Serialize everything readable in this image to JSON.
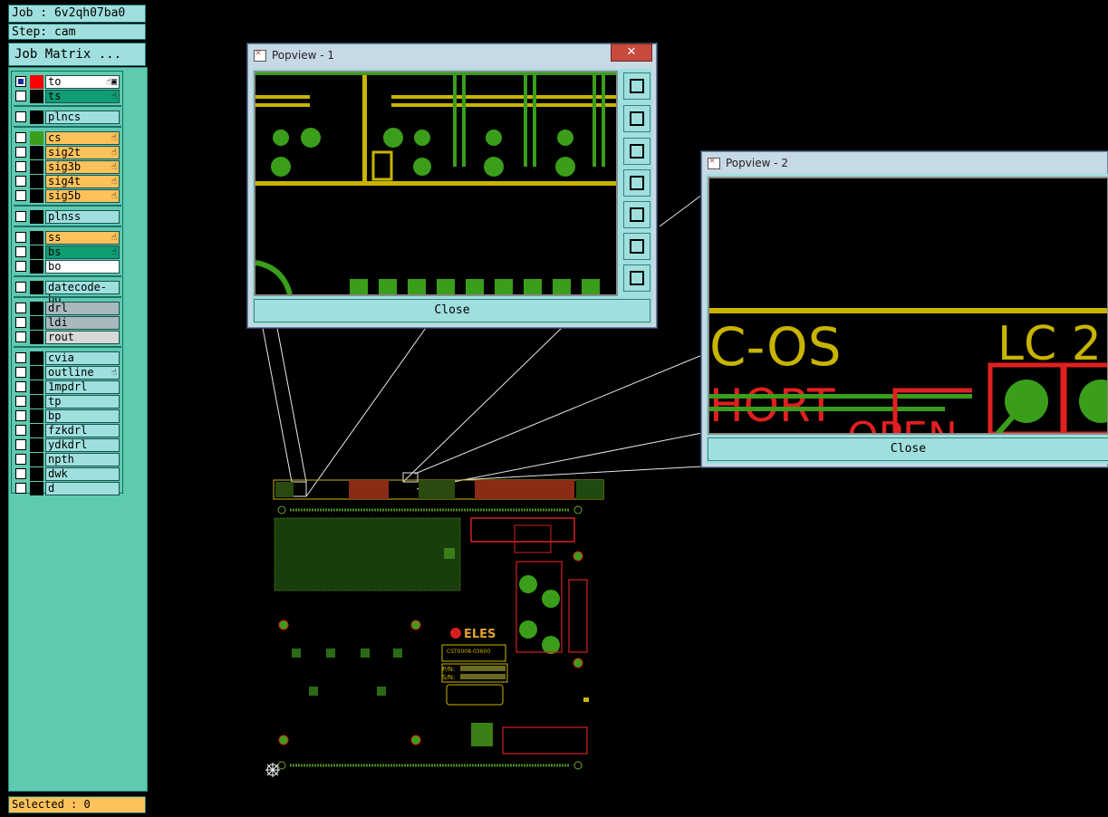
{
  "job": "Job : 6v2qh07ba0",
  "step": "Step: cam",
  "job_matrix": "Job Matrix ...",
  "selected": "Selected : 0",
  "colors": {
    "teal": "#9fe0de",
    "panel": "#5ecab0",
    "orange": "#ffc25a",
    "green": "#0f9e74",
    "silver": "#a9b8bd"
  },
  "layers": [
    {
      "name": "to",
      "bg": "#ffffff",
      "sw": "#ff0000",
      "on": true,
      "mark": "☝▣"
    },
    {
      "name": "ts",
      "bg": "#0f9e74",
      "sw": "#000000",
      "on": false,
      "mark": "☝"
    },
    {
      "name": "plncs",
      "bg": "#9fe0de",
      "sw": "#000000",
      "on": false,
      "mark": ""
    },
    {
      "name": "cs",
      "bg": "#ffc25a",
      "sw": "#3a9e1a",
      "on": false,
      "mark": "☝"
    },
    {
      "name": "sig2t",
      "bg": "#ffc25a",
      "sw": "#000000",
      "on": false,
      "mark": "☝"
    },
    {
      "name": "sig3b",
      "bg": "#ffc25a",
      "sw": "#000000",
      "on": false,
      "mark": "☝"
    },
    {
      "name": "sig4t",
      "bg": "#ffc25a",
      "sw": "#000000",
      "on": false,
      "mark": "☝"
    },
    {
      "name": "sig5b",
      "bg": "#ffc25a",
      "sw": "#000000",
      "on": false,
      "mark": "☝"
    },
    {
      "name": "plnss",
      "bg": "#9fe0de",
      "sw": "#000000",
      "on": false,
      "mark": ""
    },
    {
      "name": "ss",
      "bg": "#ffc25a",
      "sw": "#000000",
      "on": false,
      "mark": "☝"
    },
    {
      "name": "bs",
      "bg": "#0f9e74",
      "sw": "#000000",
      "on": false,
      "mark": "☝"
    },
    {
      "name": "bo",
      "bg": "#ffffff",
      "sw": "#000000",
      "on": false,
      "mark": ""
    },
    {
      "name": "datecode-bo",
      "bg": "#9fe0de",
      "sw": "#000000",
      "on": false,
      "mark": ""
    },
    {
      "name": "drl",
      "bg": "#a9b8bd",
      "sw": "#000000",
      "on": false,
      "mark": ""
    },
    {
      "name": "ldi",
      "bg": "#a9b8bd",
      "sw": "#000000",
      "on": false,
      "mark": ""
    },
    {
      "name": "rout",
      "bg": "#d8d8d8",
      "sw": "#000000",
      "on": false,
      "mark": ""
    },
    {
      "name": "cvia",
      "bg": "#9fe0de",
      "sw": "#000000",
      "on": false,
      "mark": ""
    },
    {
      "name": "outline",
      "bg": "#9fe0de",
      "sw": "#000000",
      "on": false,
      "mark": "☝"
    },
    {
      "name": "1mpdrl",
      "bg": "#9fe0de",
      "sw": "#000000",
      "on": false,
      "mark": ""
    },
    {
      "name": "tp",
      "bg": "#9fe0de",
      "sw": "#000000",
      "on": false,
      "mark": ""
    },
    {
      "name": "bp",
      "bg": "#9fe0de",
      "sw": "#000000",
      "on": false,
      "mark": ""
    },
    {
      "name": "fzkdrl",
      "bg": "#9fe0de",
      "sw": "#000000",
      "on": false,
      "mark": ""
    },
    {
      "name": "ydkdrl",
      "bg": "#9fe0de",
      "sw": "#000000",
      "on": false,
      "mark": ""
    },
    {
      "name": "npth",
      "bg": "#9fe0de",
      "sw": "#000000",
      "on": false,
      "mark": ""
    },
    {
      "name": "dwk",
      "bg": "#9fe0de",
      "sw": "#000000",
      "on": false,
      "mark": ""
    },
    {
      "name": "d",
      "bg": "#9fe0de",
      "sw": "#000000",
      "on": false,
      "mark": ""
    }
  ],
  "popview1": {
    "title": "Popview - 1",
    "close_label": "Close",
    "x_label": "✕"
  },
  "popview2": {
    "title": "Popview - 2",
    "close_label": "Close"
  },
  "board_text": {
    "brand": "ELES",
    "part": "CST0008-03600",
    "pn": "P/N:",
    "sn": "S/N:",
    "zoom_text_1": "C-OS",
    "zoom_text_2": "LC 2",
    "zoom_text_3": "HORT",
    "zoom_text_4": "OPEN"
  }
}
